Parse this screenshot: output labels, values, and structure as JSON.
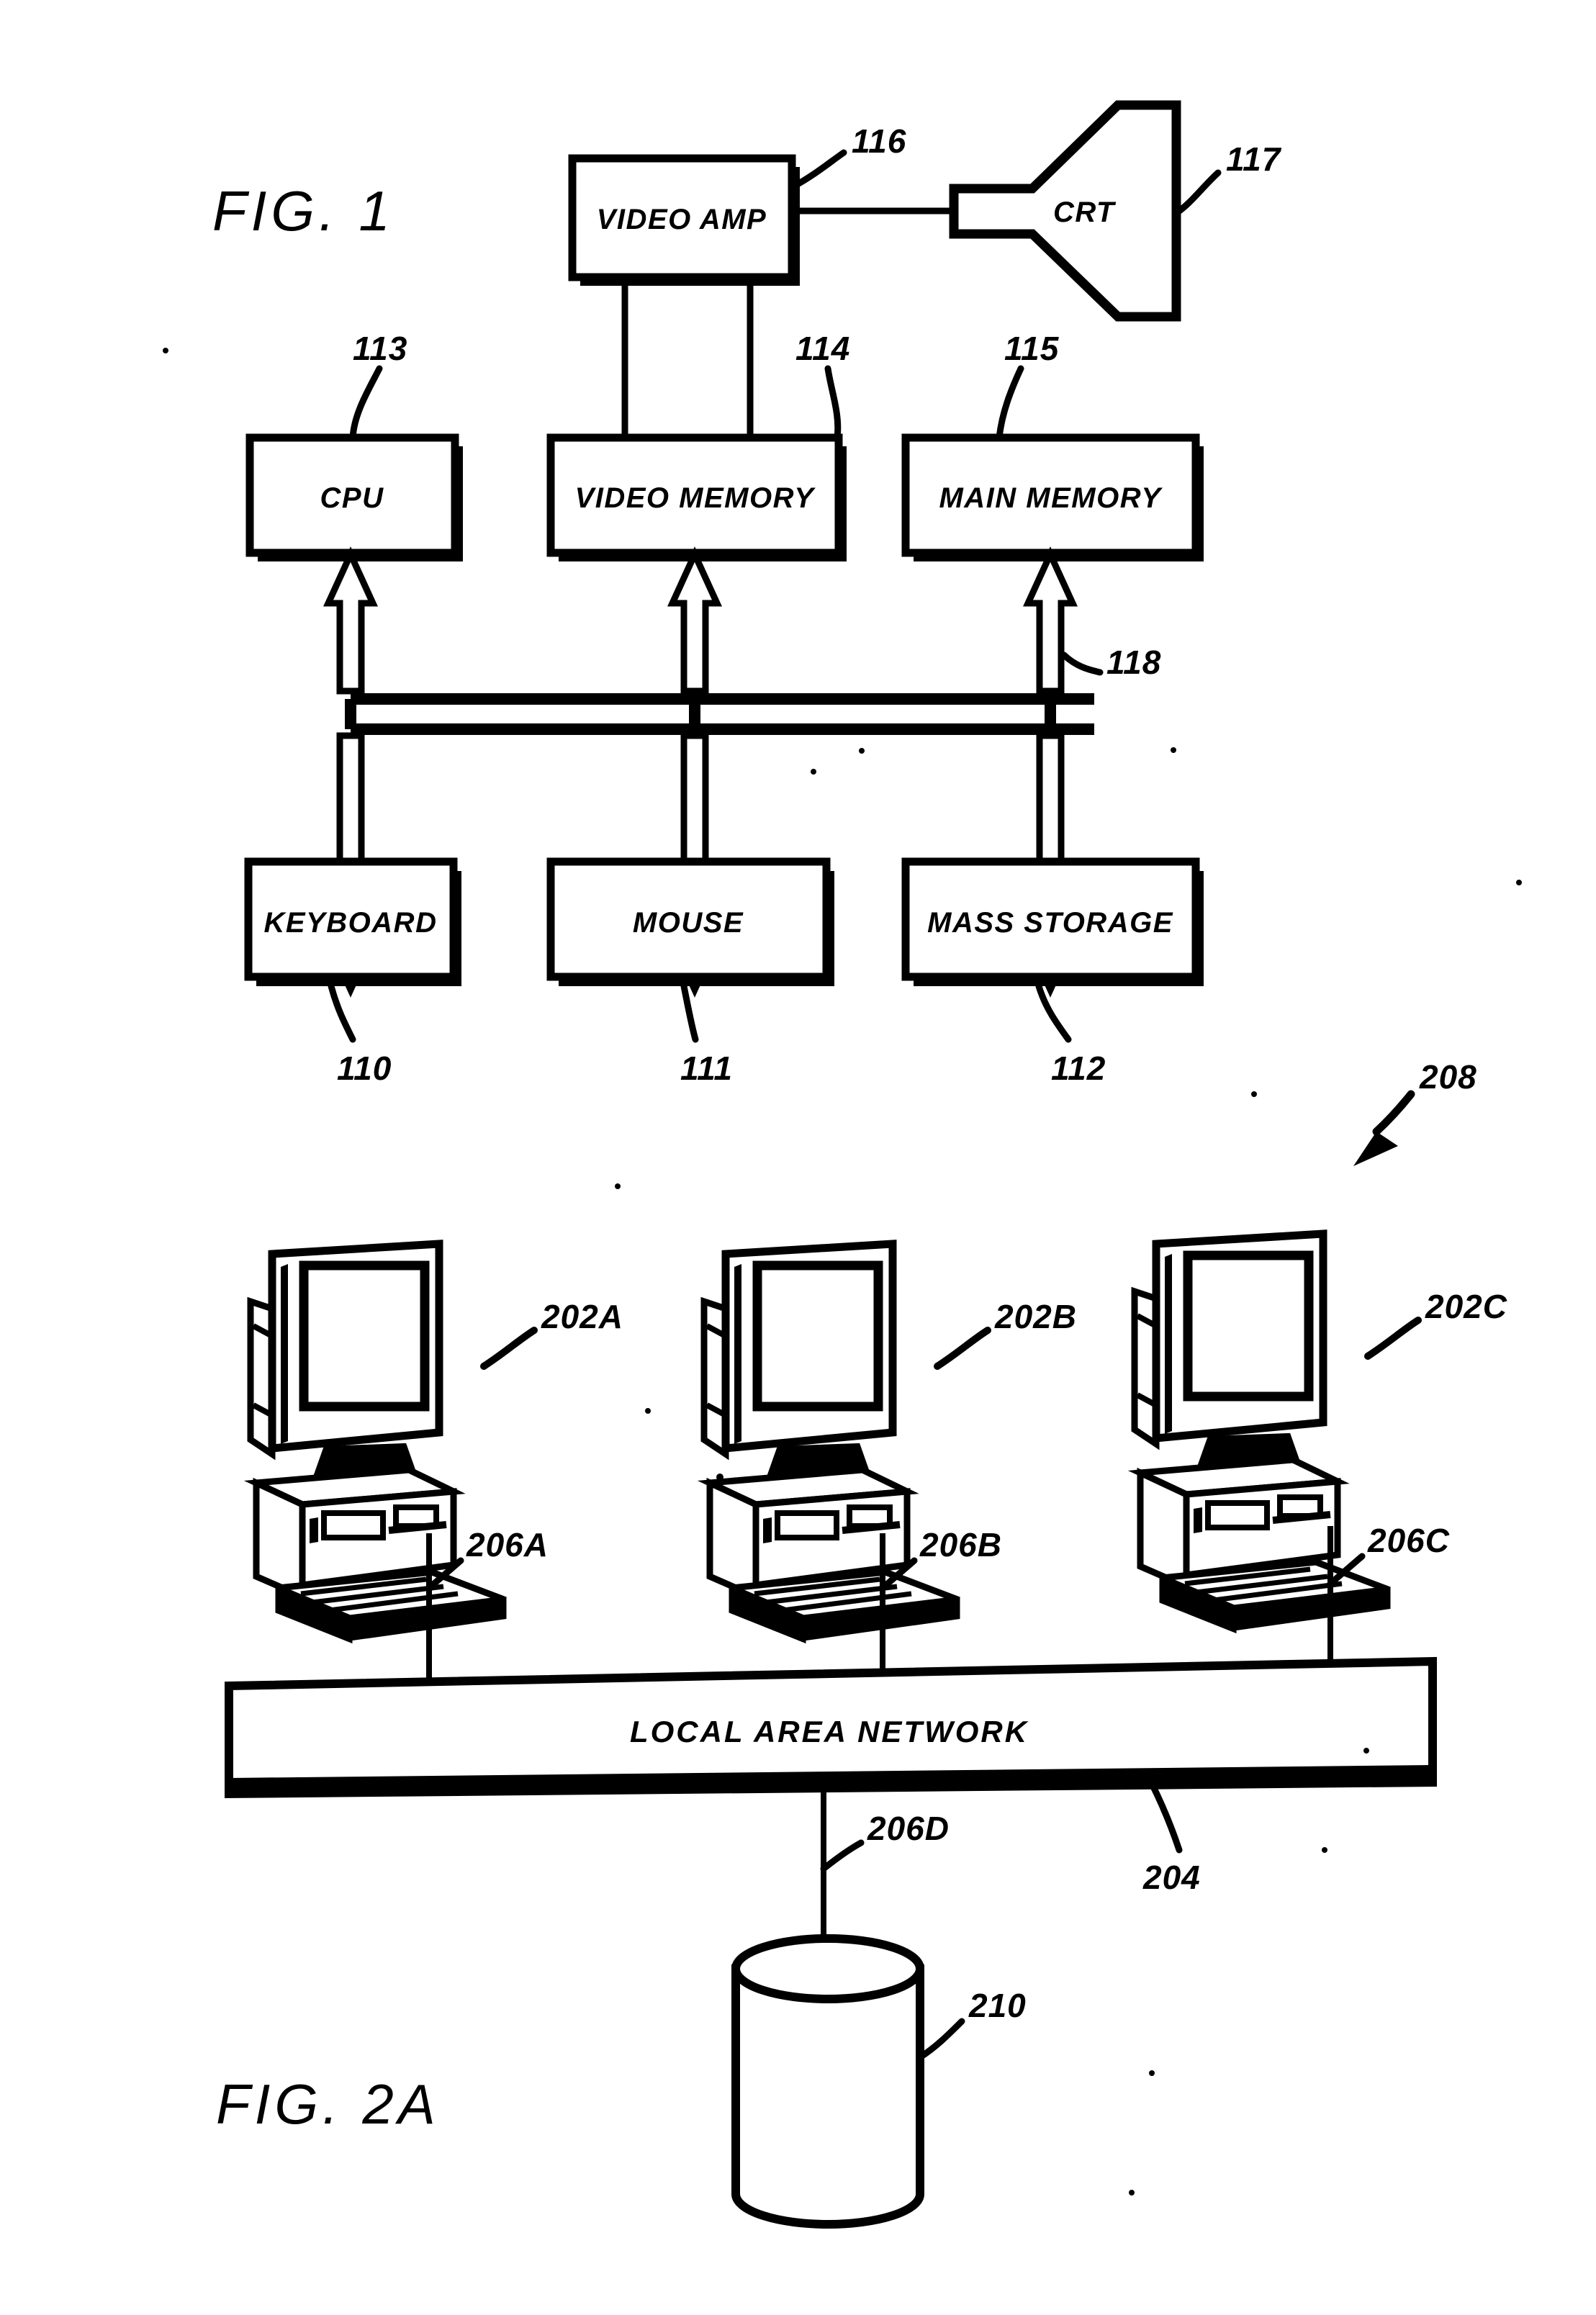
{
  "figures": [
    {
      "id": "fig1",
      "title": "FIG.  1",
      "blocks": [
        {
          "key": "video_amp",
          "label": "VIDEO AMP",
          "ref": "116"
        },
        {
          "key": "crt",
          "label": "CRT",
          "ref": "117"
        },
        {
          "key": "cpu",
          "label": "CPU",
          "ref": "113"
        },
        {
          "key": "video_memory",
          "label": "VIDEO MEMORY",
          "ref": "114"
        },
        {
          "key": "main_memory",
          "label": "MAIN MEMORY",
          "ref": "115"
        },
        {
          "key": "keyboard",
          "label": "KEYBOARD",
          "ref": "110"
        },
        {
          "key": "mouse",
          "label": "MOUSE",
          "ref": "111"
        },
        {
          "key": "mass_storage",
          "label": "MASS STORAGE",
          "ref": "112"
        }
      ],
      "bus": {
        "ref": "118"
      }
    },
    {
      "id": "fig2a",
      "title": "FIG.  2A",
      "system_ref": "208",
      "workstations": [
        {
          "key": "ws_a",
          "ref": "202A",
          "link_ref": "206A"
        },
        {
          "key": "ws_b",
          "ref": "202B",
          "link_ref": "206B"
        },
        {
          "key": "ws_c",
          "ref": "202C",
          "link_ref": "206C"
        }
      ],
      "network": {
        "label": "LOCAL AREA NETWORK",
        "ref": "204"
      },
      "server_link": {
        "ref": "206D"
      },
      "database": {
        "ref": "210"
      }
    }
  ],
  "labels": {
    "fig1_title": "FIG.  1",
    "fig2a_title": "FIG.  2A",
    "video_amp": "VIDEO AMP",
    "crt": "CRT",
    "cpu": "CPU",
    "video_memory": "VIDEO MEMORY",
    "main_memory": "MAIN MEMORY",
    "keyboard": "KEYBOARD",
    "mouse": "MOUSE",
    "mass_storage": "MASS STORAGE",
    "local_area_network": "LOCAL AREA NETWORK"
  },
  "refs": {
    "r110": "110",
    "r111": "111",
    "r112": "112",
    "r113": "113",
    "r114": "114",
    "r115": "115",
    "r116": "116",
    "r117": "117",
    "r118": "118",
    "r202a": "202A",
    "r202b": "202B",
    "r202c": "202C",
    "r204": "204",
    "r206a": "206A",
    "r206b": "206B",
    "r206c": "206C",
    "r206d": "206D",
    "r208": "208",
    "r210": "210"
  },
  "colors": {
    "ink": "#000000",
    "paper": "#ffffff"
  }
}
